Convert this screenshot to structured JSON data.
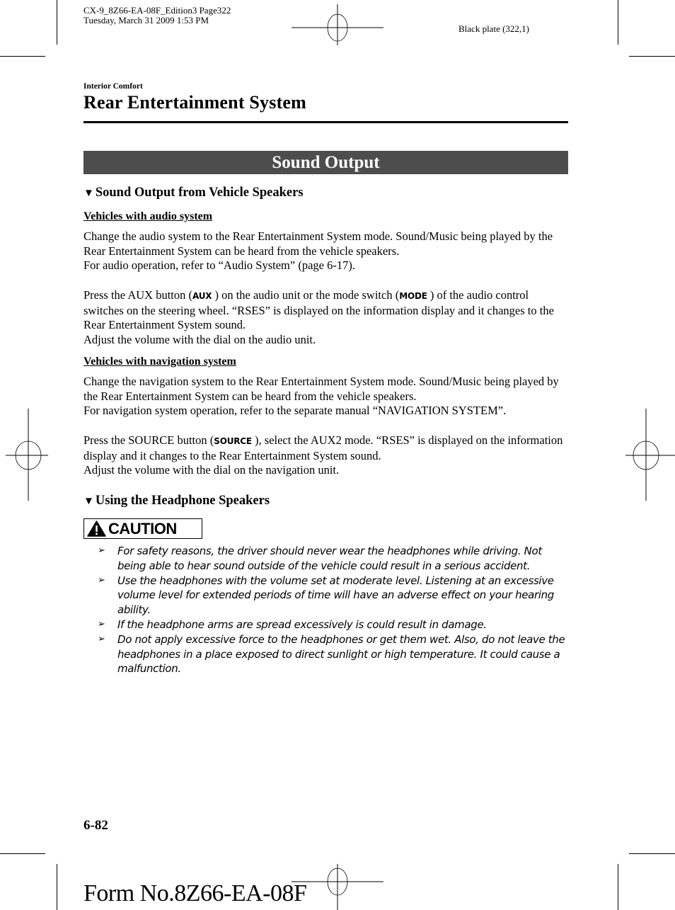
{
  "header": {
    "file_line": "CX-9_8Z66-EA-08F_Edition3 Page322",
    "date_line": "Tuesday, March 31 2009 1:53 PM",
    "plate": "Black plate (322,1)"
  },
  "section_label": "Interior Comfort",
  "page_title": "Rear Entertainment System",
  "banner_title": "Sound Output",
  "sections": [
    {
      "heading_marker": "▼",
      "heading": "Sound Output from Vehicle Speakers",
      "subsections": [
        {
          "title": "Vehicles with audio system",
          "para1": "Change the audio system to the Rear Entertainment System mode. Sound/Music being played by the Rear Entertainment System can be heard from the vehicle speakers.",
          "para1b": "For audio operation, refer to “Audio System” (page 6-17).",
          "para2_a": "Press the AUX button (",
          "para2_btn1": "AUX",
          "para2_b": " ) on the audio unit or the mode switch (",
          "para2_btn2": "MODE",
          "para2_c": " ) of the audio control switches on the steering wheel. “RSES” is displayed on the information display and it changes to the Rear Entertainment System sound.",
          "para2_d": "Adjust the volume with the dial on the audio unit."
        },
        {
          "title": "Vehicles with navigation system",
          "para1": "Change the navigation system to the Rear Entertainment System mode. Sound/Music being played by the Rear Entertainment System can be heard from the vehicle speakers.",
          "para1b": "For navigation system operation, refer to the separate manual “NAVIGATION SYSTEM”.",
          "para2_a": "Press the SOURCE button (",
          "para2_btn1": "SOURCE",
          "para2_b": " ), select the AUX2 mode. “RSES” is displayed on the information display and it changes to the Rear Entertainment System sound.",
          "para2_d": "Adjust the volume with the dial on the navigation unit."
        }
      ]
    },
    {
      "heading_marker": "▼",
      "heading": "Using the Headphone Speakers"
    }
  ],
  "caution": {
    "label": "CAUTION",
    "icon": "warning-triangle-icon",
    "bullet": "➢",
    "items": [
      "For safety reasons, the driver should never wear the headphones while driving. Not being able to hear sound outside of the vehicle could result in a serious accident.",
      "Use the headphones with the volume set at moderate level. Listening at an excessive volume level for extended periods of time will have an adverse effect on your hearing ability.",
      "If the headphone arms are spread excessively is could result in damage.",
      "Do not apply excessive force to the headphones or get them wet. Also, do not leave the headphones in a place exposed to direct sunlight or high temperature. It could cause a malfunction."
    ]
  },
  "footer": {
    "page_number": "6-82",
    "form_number": "Form No.8Z66-EA-08F"
  },
  "colors": {
    "banner_bg": "#4d4d4d",
    "text": "#000000"
  }
}
